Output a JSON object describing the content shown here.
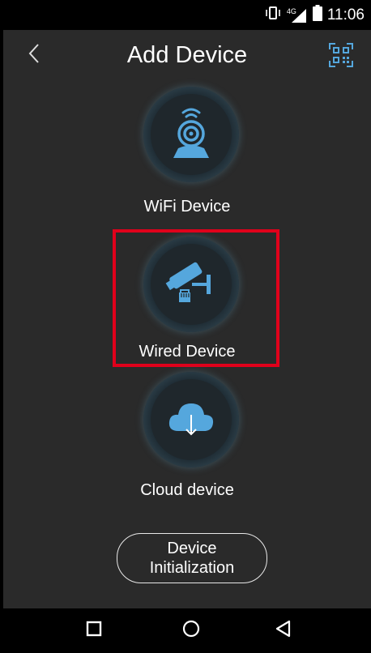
{
  "status_bar": {
    "network_label": "4G",
    "time": "11:06",
    "icons": [
      "vibrate-icon",
      "cellular-signal-icon",
      "battery-icon"
    ]
  },
  "header": {
    "title": "Add Device",
    "back_icon": "chevron-left-icon",
    "qr_icon": "qr-code-scan-icon"
  },
  "options": [
    {
      "label": "WiFi Device",
      "icon": "wifi-camera-icon"
    },
    {
      "label": "Wired Device",
      "icon": "wired-camera-icon"
    },
    {
      "label": "Cloud device",
      "icon": "cloud-download-icon"
    }
  ],
  "init_button": {
    "line1": "Device",
    "line2": "Initialization"
  },
  "nav": {
    "icons": [
      "recent-apps-icon",
      "home-icon",
      "back-triangle-icon"
    ]
  },
  "colors": {
    "app_background": "#2a2a2a",
    "icon_blue": "#55a7dd",
    "highlight": "#e0001b"
  }
}
